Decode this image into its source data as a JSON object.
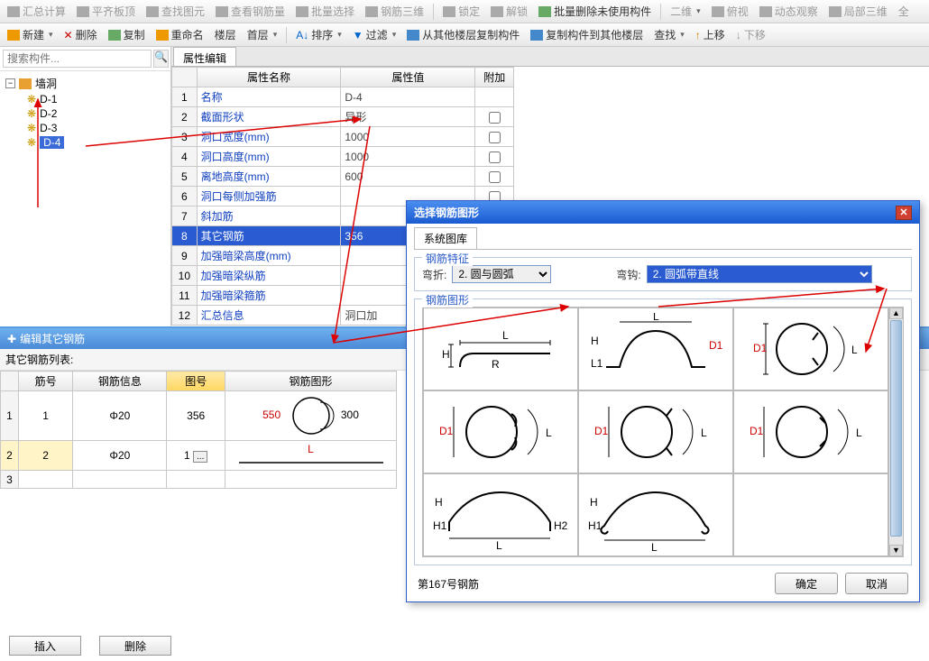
{
  "toolbar1": {
    "calc": "汇总计算",
    "flat": "平齐板顶",
    "find_elem": "查找图元",
    "view_rebar": "查看钢筋量",
    "batch_sel": "批量选择",
    "rebar_3d": "钢筋三维",
    "lock": "锁定",
    "unlock": "解锁",
    "batch_del": "批量删除未使用构件",
    "dim_2d": "二维",
    "overlook": "俯视",
    "dyn_obs": "动态观察",
    "local_3d": "局部三维",
    "all": "全"
  },
  "toolbar2": {
    "new": "新建",
    "del": "删除",
    "copy": "复制",
    "rename": "重命名",
    "floor_lbl": "楼层",
    "floor_val": "首层",
    "sort": "排序",
    "filter": "过滤",
    "copy_from": "从其他楼层复制构件",
    "copy_to": "复制构件到其他楼层",
    "find": "查找",
    "up": "上移",
    "down": "下移"
  },
  "search": {
    "placeholder": "搜索构件..."
  },
  "tree": {
    "root": "墙洞",
    "items": [
      "D-1",
      "D-2",
      "D-3",
      "D-4"
    ],
    "selected": "D-4"
  },
  "prop_tab": "属性编辑",
  "prop_headers": {
    "name": "属性名称",
    "value": "属性值",
    "attach": "附加"
  },
  "props": [
    {
      "n": 1,
      "name": "名称",
      "val": "D-4",
      "chk": null
    },
    {
      "n": 2,
      "name": "截面形状",
      "val": "异形",
      "chk": false
    },
    {
      "n": 3,
      "name": "洞口宽度(mm)",
      "val": "1000",
      "chk": false
    },
    {
      "n": 4,
      "name": "洞口高度(mm)",
      "val": "1000",
      "chk": false
    },
    {
      "n": 5,
      "name": "离地高度(mm)",
      "val": "600",
      "chk": false
    },
    {
      "n": 6,
      "name": "洞口每侧加强筋",
      "val": "",
      "chk": false
    },
    {
      "n": 7,
      "name": "斜加筋",
      "val": "",
      "chk": false
    },
    {
      "n": 8,
      "name": "其它钢筋",
      "val": "356",
      "chk": null,
      "sel": true
    },
    {
      "n": 9,
      "name": "加强暗梁高度(mm)",
      "val": "",
      "chk": false
    },
    {
      "n": 10,
      "name": "加强暗梁纵筋",
      "val": "",
      "chk": false
    },
    {
      "n": 11,
      "name": "加强暗梁箍筋",
      "val": "",
      "chk": false
    },
    {
      "n": 12,
      "name": "汇总信息",
      "val": "洞口加",
      "chk": null
    }
  ],
  "bottom": {
    "title": "编辑其它钢筋",
    "subtitle": "其它钢筋列表:",
    "headers": {
      "id": "筋号",
      "info": "钢筋信息",
      "shape_no": "图号",
      "shape": "钢筋图形"
    },
    "rows": [
      {
        "rn": 1,
        "id": "1",
        "info": "Φ20",
        "shape_no": "356",
        "d1": "550",
        "d2": "300"
      },
      {
        "rn": 2,
        "id": "2",
        "info": "Φ20",
        "shape_no": "1",
        "lbl": "L",
        "edit": true
      }
    ],
    "rn3": "3",
    "insert": "插入",
    "delete": "删除"
  },
  "dialog": {
    "title": "选择钢筋图形",
    "tab": "系统图库",
    "fs1_legend": "钢筋特征",
    "bend_lbl": "弯折:",
    "bend_val": "2. 圆与圆弧",
    "hook_lbl": "弯钩:",
    "hook_val": "2. 圆弧带直线",
    "fs2_legend": "钢筋图形",
    "status": "第167号钢筋",
    "ok": "确定",
    "cancel": "取消"
  }
}
